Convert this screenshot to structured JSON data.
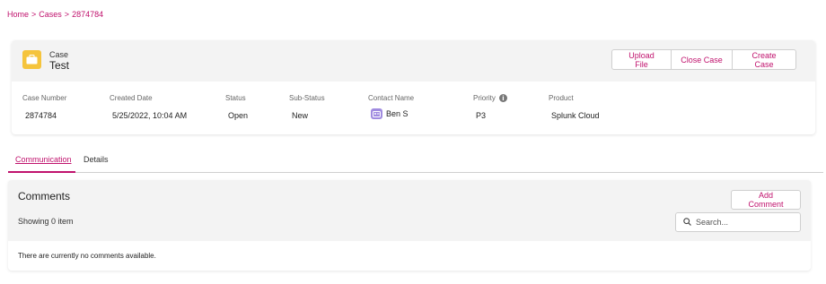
{
  "breadcrumb": {
    "items": [
      "Home",
      "Cases",
      "2874784"
    ],
    "separator": ">"
  },
  "case": {
    "type_label": "Case",
    "name": "Test",
    "icon": "briefcase-icon",
    "icon_color": "#f5c43c",
    "actions": {
      "upload": "Upload File",
      "close": "Close Case",
      "create": "Create Case"
    },
    "fields": {
      "case_number": {
        "label": "Case Number",
        "value": "2874784"
      },
      "created_date": {
        "label": "Created Date",
        "value": "5/25/2022, 10:04 AM"
      },
      "status": {
        "label": "Status",
        "value": "Open"
      },
      "sub_status": {
        "label": "Sub-Status",
        "value": "New"
      },
      "contact_name": {
        "label": "Contact Name",
        "value": "Ben S"
      },
      "priority": {
        "label": "Priority",
        "value": "P3"
      },
      "product": {
        "label": "Product",
        "value": "Splunk Cloud"
      }
    }
  },
  "tabs": [
    {
      "label": "Communication",
      "active": true
    },
    {
      "label": "Details",
      "active": false
    }
  ],
  "comments": {
    "title": "Comments",
    "add_label": "Add Comment",
    "showing": "Showing 0 item",
    "search_placeholder": "Search...",
    "empty_message": "There are currently no comments available."
  },
  "colors": {
    "accent": "#c0126d",
    "panel_bg": "#f3f3f3",
    "contact_icon": "#a08be0"
  }
}
